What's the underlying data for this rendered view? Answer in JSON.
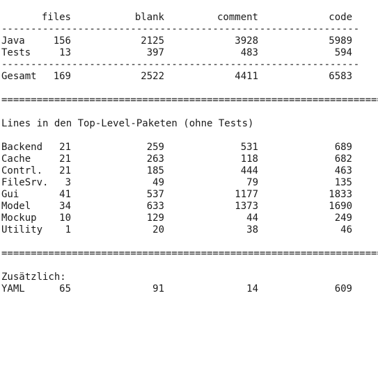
{
  "header": {
    "files": "files",
    "blank": "blank",
    "comment": "comment",
    "code": "code"
  },
  "dash_line": "-------------------------------------------------------------",
  "eq_line": "==================================================================",
  "totals": {
    "rows": [
      {
        "name": "Java",
        "files": "156",
        "blank": "2125",
        "comment": "3928",
        "code": "5989"
      },
      {
        "name": "Tests",
        "files": "13",
        "blank": "397",
        "comment": "483",
        "code": "594"
      }
    ],
    "sum": {
      "name": "Gesamt",
      "files": "169",
      "blank": "2522",
      "comment": "4411",
      "code": "6583"
    }
  },
  "packages": {
    "heading": "Lines in den Top-Level-Paketen (ohne Tests)",
    "rows": [
      {
        "name": "Backend",
        "files": "21",
        "blank": "259",
        "comment": "531",
        "code": "689"
      },
      {
        "name": "Cache",
        "files": "21",
        "blank": "263",
        "comment": "118",
        "code": "682"
      },
      {
        "name": "Contrl.",
        "files": "21",
        "blank": "185",
        "comment": "444",
        "code": "463"
      },
      {
        "name": "FileSrv.",
        "files": "3",
        "blank": "49",
        "comment": "79",
        "code": "135"
      },
      {
        "name": "Gui",
        "files": "41",
        "blank": "537",
        "comment": "1177",
        "code": "1833"
      },
      {
        "name": "Model",
        "files": "34",
        "blank": "633",
        "comment": "1373",
        "code": "1690"
      },
      {
        "name": "Mockup",
        "files": "10",
        "blank": "129",
        "comment": "44",
        "code": "249"
      },
      {
        "name": "Utility",
        "files": "1",
        "blank": "20",
        "comment": "38",
        "code": "46"
      }
    ]
  },
  "extra": {
    "heading": "Zusätzlich:",
    "rows": [
      {
        "name": "YAML",
        "files": "65",
        "blank": "91",
        "comment": "14",
        "code": "609"
      }
    ]
  }
}
